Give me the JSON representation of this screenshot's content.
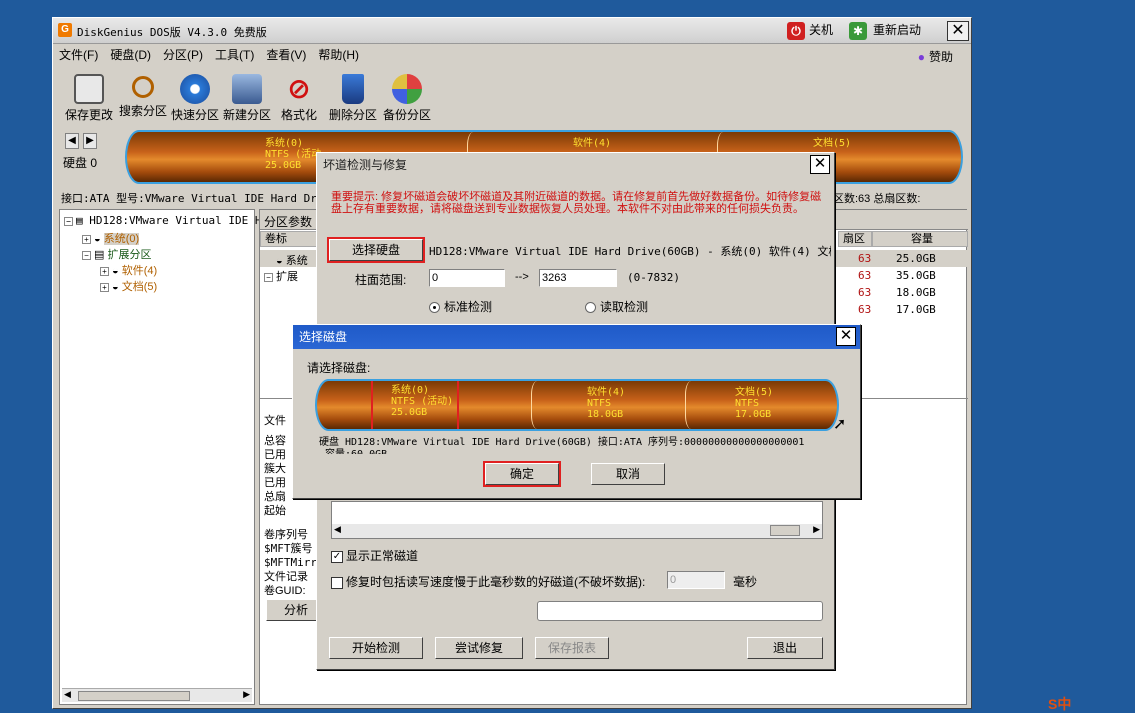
{
  "app": {
    "title": "DiskGenius DOS版 V4.3.0 免费版",
    "shutdown_label": "关机",
    "restart_label": "重新启动",
    "sponsor_label": "赞助"
  },
  "menu": [
    "文件(F)",
    "硬盘(D)",
    "分区(P)",
    "工具(T)",
    "查看(V)",
    "帮助(H)"
  ],
  "toolbar": {
    "save": "保存更改",
    "search": "搜索分区",
    "quick": "快速分区",
    "new": "新建分区",
    "format": "格式化",
    "delete": "删除分区",
    "backup": "备份分区"
  },
  "diskbar": {
    "disk_label": "硬盘 0",
    "seg1": {
      "name": "系统(0)",
      "fs": "NTFS (活动",
      "size": "25.0GB"
    },
    "seg2": {
      "name": "软件(4)"
    },
    "seg3": {
      "name": "文档(5)",
      "size": "GB"
    }
  },
  "infobar": {
    "left": "接口:ATA  型号:VMware Virtual IDE Hard Driv",
    "right": "区数:63  总扇区数:"
  },
  "tree": {
    "root": "HD128:VMware Virtual IDE H:",
    "sys": "系统(0)",
    "ext": "扩展分区",
    "soft": "软件(4)",
    "doc": "文档(5)"
  },
  "rightpane": {
    "tab": "分区参数",
    "col_label": "卷标",
    "col_sector": "扇区",
    "col_size": "容量",
    "row_sys": "系统",
    "row_ext": "扩展",
    "sectors": [
      "63",
      "63",
      "63",
      "63"
    ],
    "sizes": [
      "25.0GB",
      "35.0GB",
      "18.0GB",
      "17.0GB"
    ],
    "side_labels": [
      "文件",
      "总容",
      "已用",
      "簇大",
      "已用",
      "总扇",
      "起始",
      "卷序列号",
      "$MFT簇号",
      "$MFTMirr",
      "文件记录",
      "卷GUID:"
    ],
    "analyze": "分析"
  },
  "badtrack": {
    "title": "坏道检测与修复",
    "warning": "重要提示: 修复坏磁道会破坏坏磁道及其附近磁道的数据。请在修复前首先做好数据备份。如待修复磁盘上存有重要数据，请将磁盘送到专业数据恢复人员处理。本软件不对由此带来的任何损失负责。",
    "select_disk": "选择硬盘",
    "disk_desc": "HD128:VMware Virtual IDE Hard Drive(60GB) - 系统(0) 软件(4) 文档(",
    "cyl_label": "柱面范围:",
    "cyl_from": "0",
    "arrow": "-->",
    "cyl_to": "3263",
    "cyl_range": "(0-7832)",
    "std_check": "标准检测",
    "read_check": "读取检测",
    "show_normal": "显示正常磁道",
    "repair_slow": "修复时包括读写速度慢于此毫秒数的好磁道(不破坏数据):",
    "ms_value": "0",
    "ms_unit": "毫秒",
    "start": "开始检测",
    "try_repair": "尝试修复",
    "save_report": "保存报表",
    "exit": "退出"
  },
  "seldisk": {
    "title": "选择磁盘",
    "prompt": "请选择磁盘:",
    "seg1": {
      "name": "系统(0)",
      "fs": "NTFS (活动)",
      "size": "25.0GB"
    },
    "seg2": {
      "name": "软件(4)",
      "fs": "NTFS",
      "size": "18.0GB"
    },
    "seg3": {
      "name": "文档(5)",
      "fs": "NTFS",
      "size": "17.0GB"
    },
    "disk_info": "硬盘 HD128:VMware Virtual IDE Hard Drive(60GB)   接口:ATA  序列号:00000000000000000001",
    "capacity": "容量:60.0GB",
    "ok": "确定",
    "cancel": "取消"
  },
  "ime": "S中"
}
